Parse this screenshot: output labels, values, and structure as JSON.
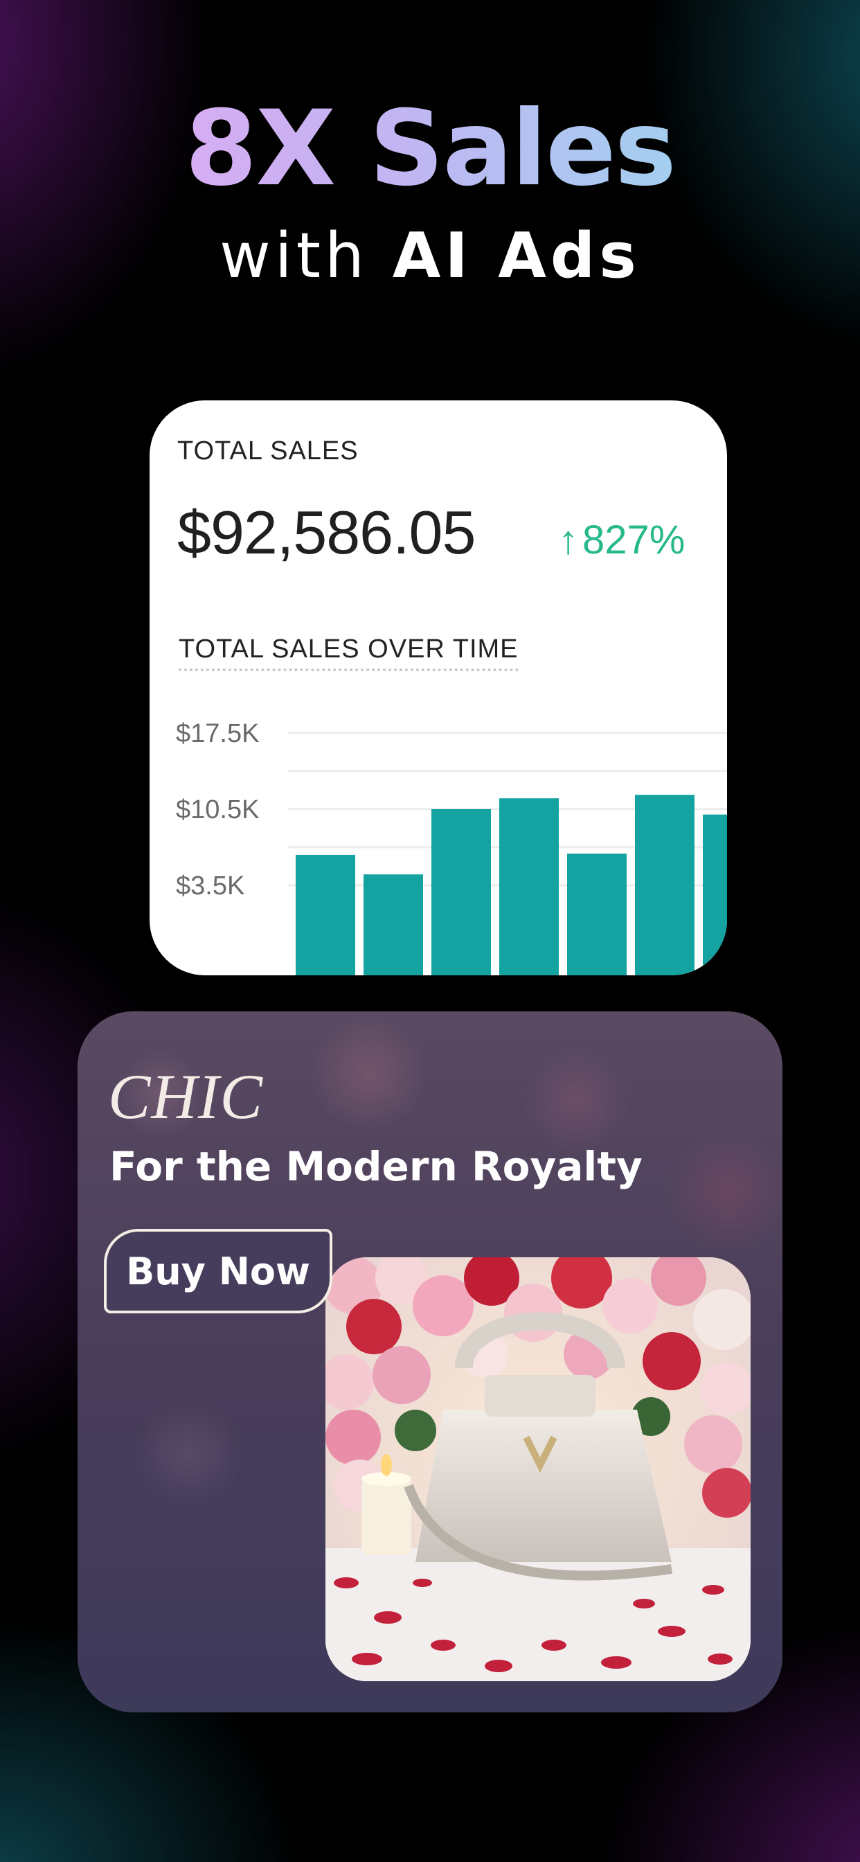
{
  "headline": {
    "main": "8X Sales",
    "sub_light": "with ",
    "sub_bold": "AI Ads"
  },
  "sales_card": {
    "label": "TOTAL SALES",
    "value": "$92,586.05",
    "change_arrow": "↑",
    "change_pct": "827%",
    "chart_title": "TOTAL SALES OVER TIME"
  },
  "chart_data": {
    "type": "bar",
    "title": "TOTAL SALES OVER TIME",
    "ytick_labels": [
      "$17.5K",
      "$10.5K",
      "$3.5K"
    ],
    "yticks": [
      17500,
      10500,
      3500
    ],
    "ylim": [
      0,
      17500
    ],
    "values": [
      6300,
      4500,
      10500,
      11500,
      6400,
      11800,
      10000
    ],
    "bar_color": "#14a3a0",
    "grid": true
  },
  "ad_card": {
    "brand": "CHIC",
    "tagline": "For the Modern Royalty",
    "button_label": "Buy Now"
  },
  "colors": {
    "positive": "#27b98c",
    "button_bg": "#463d5c"
  }
}
